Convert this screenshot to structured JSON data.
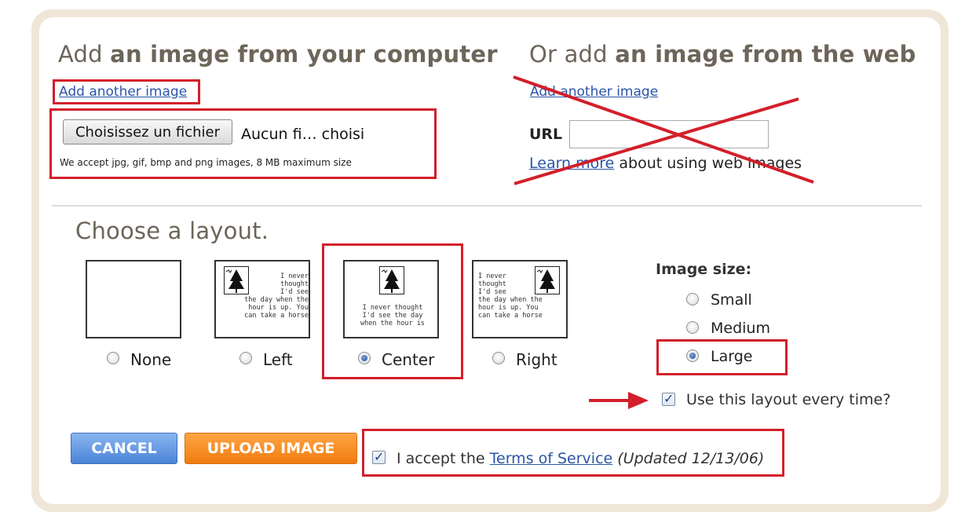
{
  "upload_local": {
    "title_plain": "Add ",
    "title_bold": "an image from your computer",
    "add_another": "Add another image",
    "choose_file_button": "Choisissez un fichier",
    "file_status": "Aucun fi… choisi",
    "accept_note": "We accept jpg, gif, bmp and png images, 8 MB maximum size"
  },
  "upload_web": {
    "title_plain": "Or add ",
    "title_bold": "an image from the web",
    "add_another": "Add another image",
    "url_label": "URL",
    "url_value": "",
    "learn_more": "Learn more",
    "learn_more_suffix": " about using web images"
  },
  "layout": {
    "heading": "Choose a layout.",
    "options": [
      {
        "label": "None",
        "selected": false
      },
      {
        "label": "Left",
        "selected": false
      },
      {
        "label": "Center",
        "selected": true
      },
      {
        "label": "Right",
        "selected": false
      }
    ],
    "sample_text_left": "I never\nthought\nI'd see\nthe day when the\nhour is up. You\ncan take a horse",
    "sample_text_center": "I never thought\nI'd see the day\nwhen the hour is",
    "sample_text_right": "I never\nthought\nI'd see\nthe day when the\nhour is up. You\ncan take a horse"
  },
  "image_size": {
    "label": "Image size:",
    "options": [
      {
        "label": "Small",
        "selected": false
      },
      {
        "label": "Medium",
        "selected": false
      },
      {
        "label": "Large",
        "selected": true
      }
    ]
  },
  "remember_layout": {
    "label": "Use this layout every time?",
    "checked": true
  },
  "actions": {
    "cancel": "CANCEL",
    "upload": "UPLOAD IMAGE"
  },
  "terms": {
    "prefix": "I accept the ",
    "link": "Terms of Service",
    "suffix": "(Updated 12/13/06)",
    "checked": true
  },
  "colors": {
    "annotation_red": "#d31f2a",
    "link_blue": "#2a55a8",
    "cancel_blue": "#4a84d8",
    "upload_orange": "#f07c0f",
    "frame_beige": "#efe6d7"
  }
}
